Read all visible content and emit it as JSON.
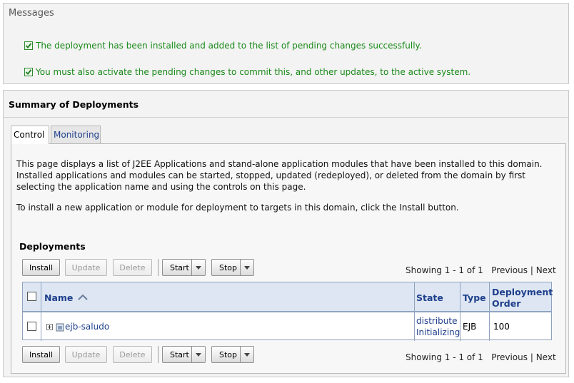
{
  "messages": {
    "title": "Messages",
    "items": [
      "The deployment has been installed and added to the list of pending changes successfully.",
      "You must also activate the pending changes to commit this, and other updates, to the active system."
    ],
    "success_color": "#1a8a1a"
  },
  "summary": {
    "title": "Summary of Deployments",
    "tabs": [
      "Control",
      "Monitoring"
    ],
    "active_tab": "Control",
    "description": "This page displays a list of J2EE Applications and stand-alone application modules that have been installed to this domain. Installed applications and modules can be started, stopped, updated (redeployed), or deleted from the domain by first selecting the application name and using the controls on this page.",
    "install_hint": "To install a new application or module for deployment to targets in this domain, click the Install button."
  },
  "deployments": {
    "title": "Deployments",
    "toolbar": {
      "install": "Install",
      "update": "Update",
      "delete": "Delete",
      "start": "Start",
      "stop": "Stop"
    },
    "pager": {
      "showing": "Showing 1 - 1 of 1",
      "previous": "Previous",
      "divider": "|",
      "next": "Next"
    },
    "columns": {
      "name": "Name",
      "sort_icon": "sort-ascending-icon",
      "state": "State",
      "type": "Type",
      "order_line1": "Deployment",
      "order_line2": "Order"
    },
    "rows": [
      {
        "name": "ejb-saludo",
        "state_line1": "distribute",
        "state_line2": "Initializing",
        "type": "EJB",
        "order": "100"
      }
    ]
  },
  "colors": {
    "link": "#1e3f8c",
    "header_bg": "#dde6f2",
    "panel_bg": "#f3f3f3"
  }
}
